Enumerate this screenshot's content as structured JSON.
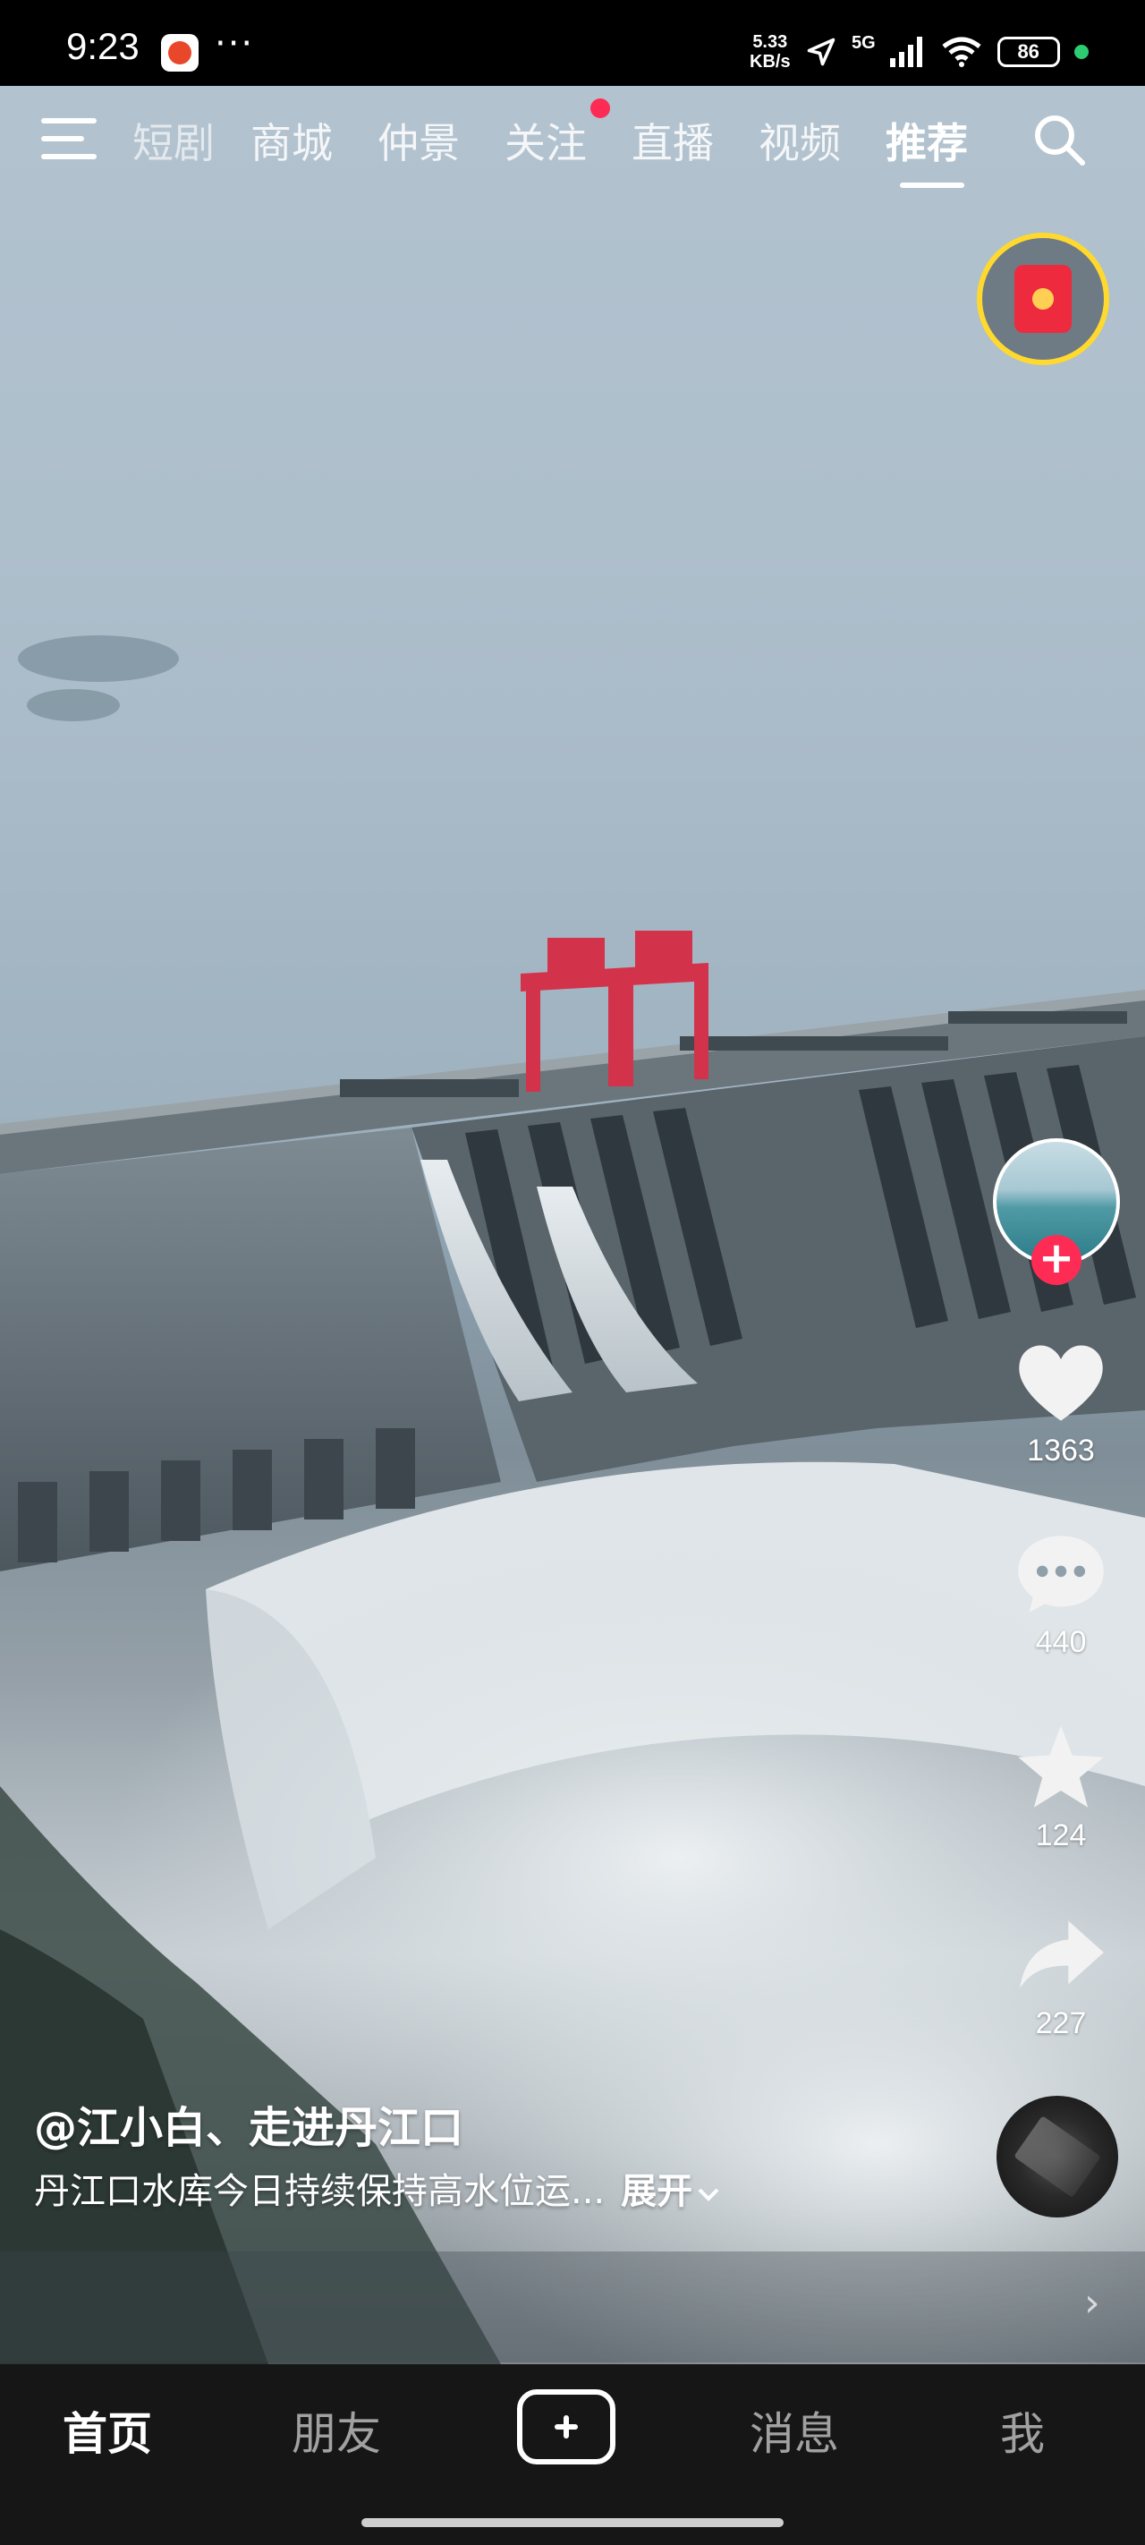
{
  "status_bar": {
    "time": "9:23",
    "network_speed_value": "5.33",
    "network_speed_unit": "KB/s",
    "network_type": "5G",
    "battery": "86",
    "indicator_dot_color": "#2ecc71"
  },
  "top_tabs": {
    "items": [
      {
        "label": "短剧"
      },
      {
        "label": "商城"
      },
      {
        "label": "仲景"
      },
      {
        "label": "关注"
      },
      {
        "label": "直播"
      },
      {
        "label": "视频"
      },
      {
        "label": "推荐"
      }
    ],
    "active": "推荐"
  },
  "actions": {
    "likes": "1363",
    "comments": "440",
    "favorites": "124",
    "shares": "227"
  },
  "video": {
    "author": "@江小白、走进丹江口",
    "description": "丹江口水库今日持续保持高水位运...",
    "expand_label": "展开"
  },
  "bottom_nav": {
    "items": [
      {
        "label": "首页"
      },
      {
        "label": "朋友"
      },
      {
        "label": "消息"
      },
      {
        "label": "我"
      }
    ],
    "active": "首页"
  },
  "colors": {
    "accent": "#fe2c55",
    "red_packet_ring": "#ffd92e",
    "gantry_crane": "#d2334a"
  }
}
